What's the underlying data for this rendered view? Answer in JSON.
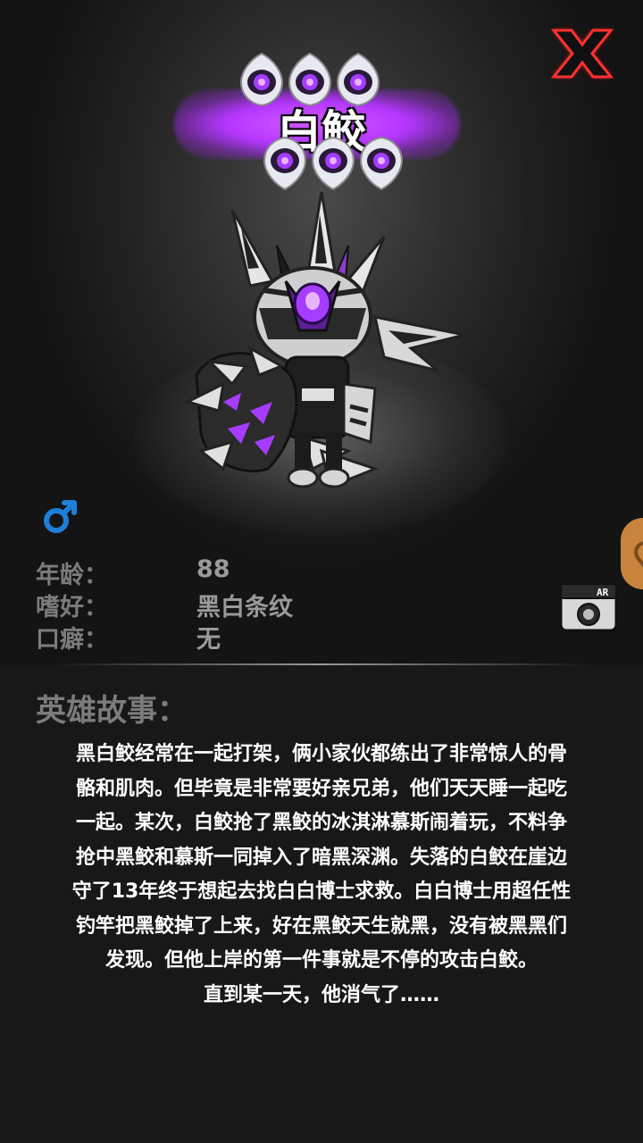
{
  "hero": {
    "name": "白鲛",
    "gender": "male",
    "gender_symbol": "♂"
  },
  "info": [
    {
      "label": "年龄：",
      "value": "88"
    },
    {
      "label": "嗜好：",
      "value": "黑白条纹"
    },
    {
      "label": "口癖：",
      "value": "无"
    }
  ],
  "story": {
    "title": "英雄故事：",
    "lines": [
      "黑白鲛经常在一起打架，俩小家伙都练出了非常惊人的骨",
      "骼和肌肉。但毕竟是非常要好亲兄弟，他们天天睡一起吃",
      "一起。某次，白鲛抢了黑鲛的冰淇淋慕斯闹着玩，不料争",
      "抢中黑鲛和慕斯一同掉入了暗黑深渊。失落的白鲛在崖边",
      "守了13年终于想起去找白白博士求救。白白博士用超任性",
      "钓竿把黑鲛掉了上来，好在黑鲛天生就黑，没有被黑黑们",
      "发现。但他上岸的第一件事就是不停的攻击白鲛。",
      "直到某一天，他消气了……"
    ]
  },
  "ar_button": {
    "label": "AR"
  },
  "icons": {
    "close": "close-x-icon",
    "gender": "male-symbol-icon",
    "ar": "ar-camera-icon",
    "rank": "purple-eye-emblem-icon",
    "side": "side-tab-icon"
  },
  "colors": {
    "accent_purple": "#b536ff",
    "close_red": "#ff1a1a",
    "gender_blue": "#1e7fd8",
    "label_gray": "#7c7c7c"
  }
}
